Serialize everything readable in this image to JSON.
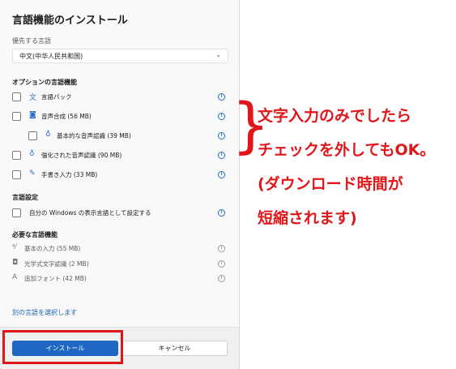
{
  "dialog": {
    "title": "言語機能のインストール",
    "preferred_label": "優先する言語",
    "language_value": "中文(中华人民共和国)",
    "optional_title": "オプションの言語機能",
    "optional_features": [
      {
        "label": "言語パック",
        "icon": "language-pack-icon"
      },
      {
        "label": "音声合成 (56 MB)",
        "icon": "speech-synthesis-icon"
      },
      {
        "label": "基本的な音声認識 (39 MB)",
        "icon": "microphone-icon"
      },
      {
        "label": "強化された音声認識 (90 MB)",
        "icon": "microphone-icon"
      },
      {
        "label": "手書き入力 (33 MB)",
        "icon": "handwriting-icon"
      }
    ],
    "settings_title": "言語設定",
    "settings_item": "自分の Windows の表示言語として設定する",
    "required_title": "必要な言語機能",
    "required_features": [
      {
        "label": "基本の入力 (55 MB)",
        "icon": "basic-typing-icon"
      },
      {
        "label": "光学式文字認識 (2 MB)",
        "icon": "camera-icon"
      },
      {
        "label": "追加フォント (42 MB)",
        "icon": "font-icon"
      }
    ],
    "other_language_link": "別の言語を選択します",
    "install_button": "インストール",
    "cancel_button": "キャンセル"
  },
  "annotation": {
    "lines": [
      "文字入力のみでしたら",
      "チェックを外してもOK。",
      "(ダウンロード時間が",
      "短縮されます)"
    ],
    "color": "#e0161a"
  }
}
